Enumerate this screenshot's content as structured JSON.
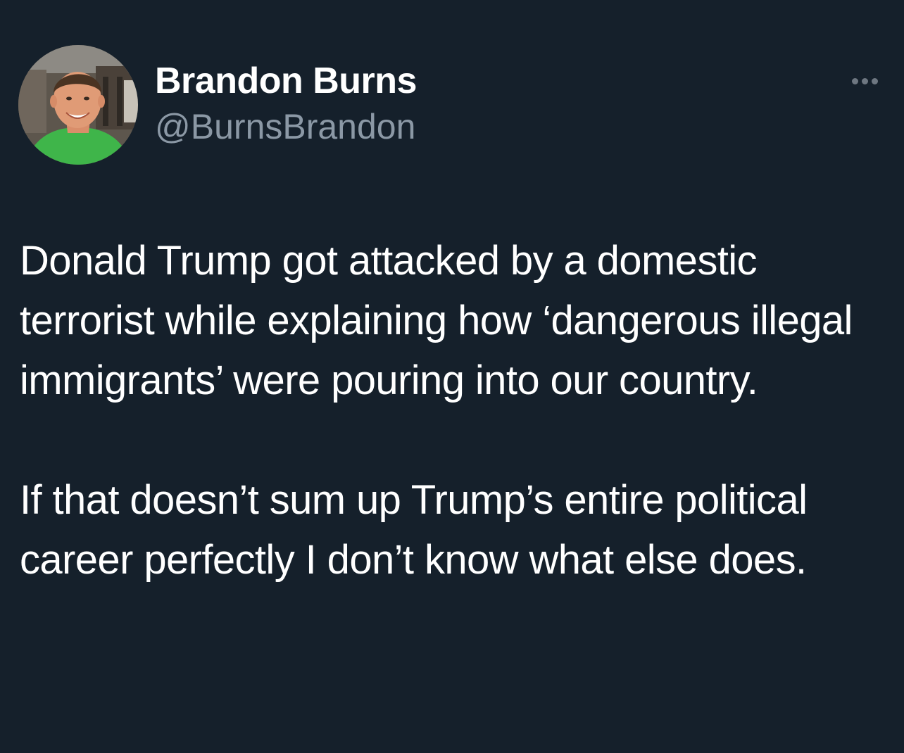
{
  "author": {
    "display_name": "Brandon Burns",
    "handle": "@BurnsBrandon",
    "avatar_icon": "profile-photo"
  },
  "more_icon": "more-horizontal-icon",
  "tweet": {
    "paragraphs": [
      "Donald Trump got attacked by a domestic terrorist while explaining how ‘dangerous illegal immigrants’ were pouring into our country.",
      "If that doesn’t sum up Trump’s entire political career perfectly I don’t know what else does."
    ]
  },
  "colors": {
    "background": "#15202b",
    "primary_text": "#ffffff",
    "secondary_text": "#8b98a5"
  }
}
